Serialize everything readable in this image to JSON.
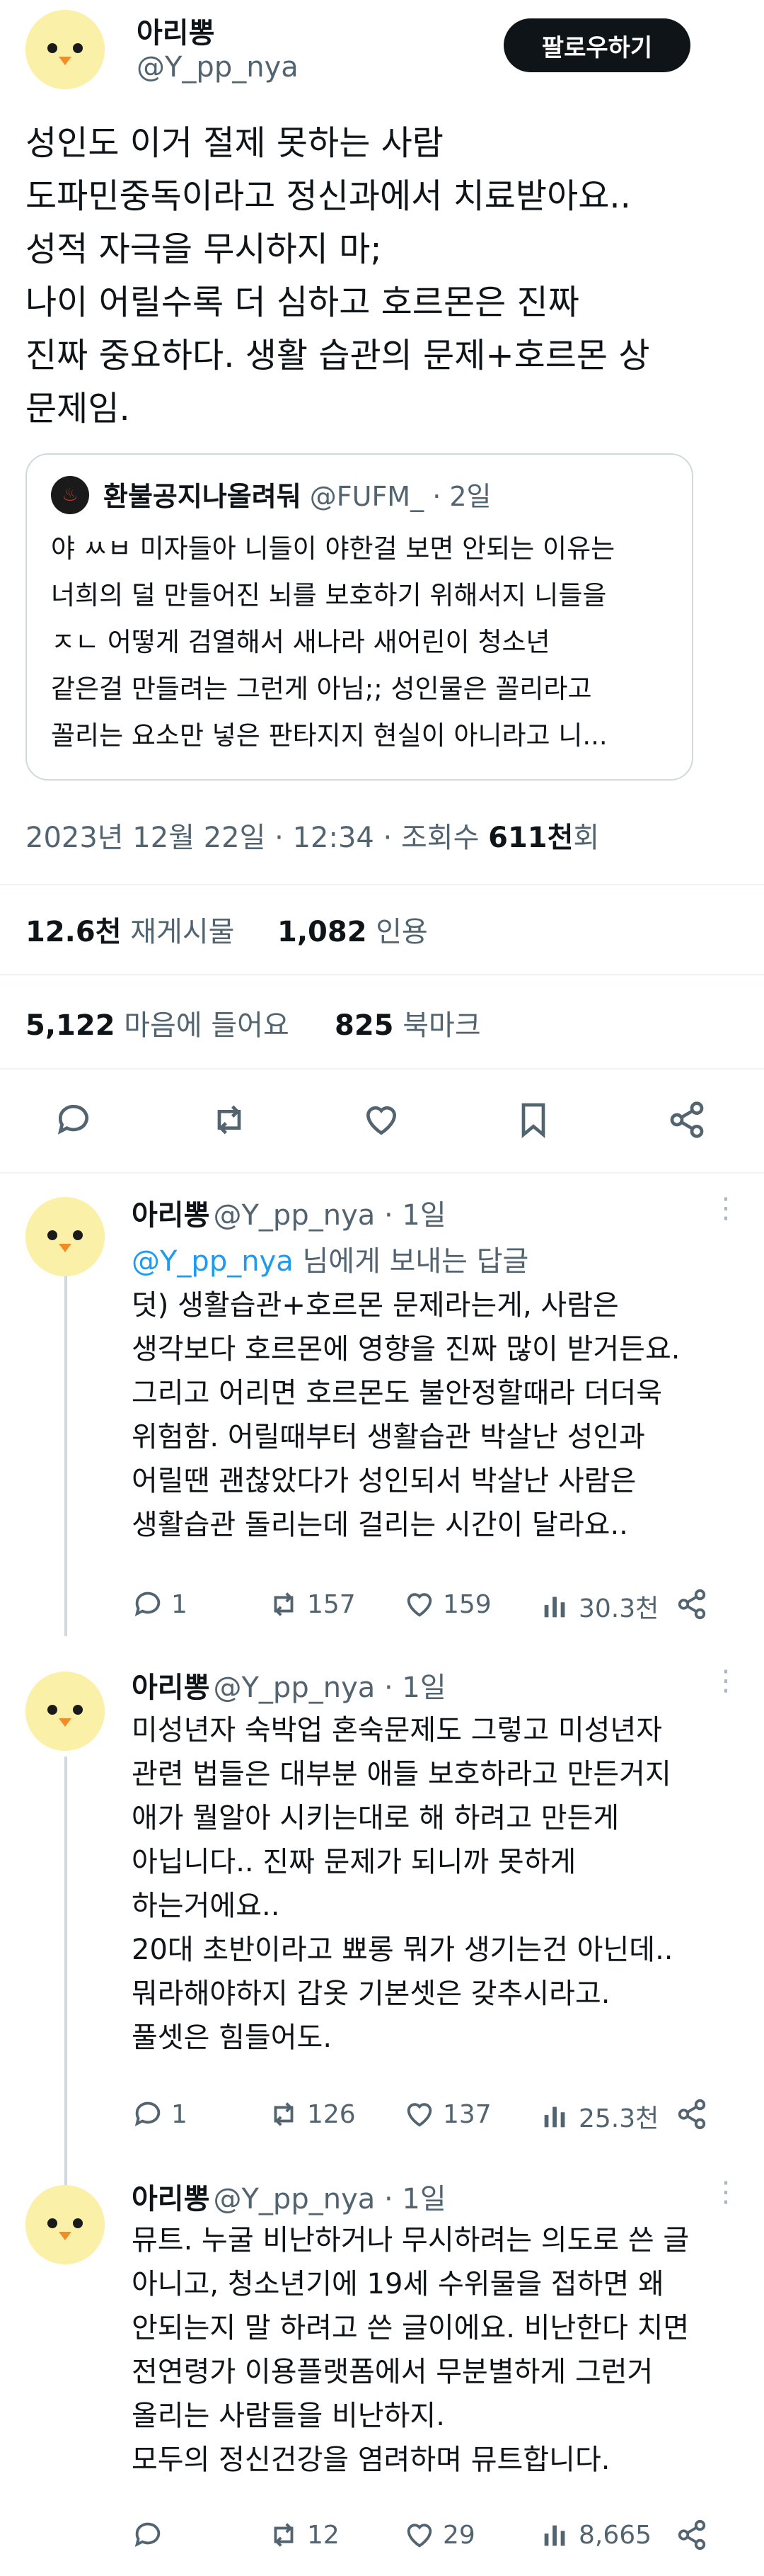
{
  "main": {
    "name": "아리뽕",
    "handle": "@Y_pp_nya",
    "follow_label": "팔로우하기",
    "body": "성인도 이거 절제 못하는 사람\n도파민중독이라고 정신과에서 치료받아요..\n성적 자극을 무시하지 마;\n나이 어릴수록 더 심하고 호르몬은 진짜\n진짜 중요하다. 생활 습관의 문제+호르몬 상\n문제임.",
    "timestamp": "2023년 12월 22일 · 12:34 · 조회수 ",
    "views": "611천",
    "views_suffix": "회",
    "retweets": "12.6천",
    "retweets_label": "재게시물",
    "quotes": "1,082",
    "quotes_label": "인용",
    "likes": "5,122",
    "likes_label": "마음에 들어요",
    "bookmarks": "825",
    "bookmarks_label": "북마크"
  },
  "quote": {
    "name": "환불공지나올려둬",
    "handle": "@FUFM_",
    "time": "· 2일",
    "text": "야 ㅆㅂ 미자들아 니들이 야한걸 보면 안되는 이유는\n너희의 덜 만들어진 뇌를 보호하기 위해서지 니들을\nㅈㄴ 어떻게 검열해서 새나라 새어린이 청소년\n같은걸 만들려는 그런게 아님;; 성인물은 꼴리라고\n꼴리는 요소만 넣은 판타지지 현실이 아니라고 니..."
  },
  "replies": [
    {
      "name": "아리뽕",
      "meta": "@Y_pp_nya · 1일",
      "reply_to_handle": "@Y_pp_nya",
      "reply_to_suffix": " 님에게 보내는 답글",
      "text": "덧) 생활습관+호르몬 문제라는게, 사람은\n생각보다 호르몬에 영향을 진짜 많이 받거든요.\n그리고 어리면 호르몬도 불안정할때라 더더욱\n위험함. 어릴때부터 생활습관 박살난 성인과\n어릴땐 괜찮았다가 성인되서 박살난 사람은\n생활습관 돌리는데 걸리는 시간이 달라요..",
      "replies": "1",
      "retweets": "157",
      "likes": "159",
      "views": "30.3천"
    },
    {
      "name": "아리뽕",
      "meta": "@Y_pp_nya · 1일",
      "text": "미성년자 숙박업 혼숙문제도 그렇고 미성년자\n관련 법들은 대부분 애들 보호하라고 만든거지\n애가 뭘알아 시키는대로 해 하려고 만든게\n아닙니다.. 진짜 문제가 되니까 못하게\n하는거에요..\n20대 초반이라고 뾰롱 뭐가 생기는건 아닌데..\n뭐라해야하지 갑옷 기본셋은 갖추시라고.\n풀셋은 힘들어도.",
      "replies": "1",
      "retweets": "126",
      "likes": "137",
      "views": "25.3천"
    },
    {
      "name": "아리뽕",
      "meta": "@Y_pp_nya · 1일",
      "text": "뮤트. 누굴 비난하거나 무시하려는 의도로 쓴 글\n아니고, 청소년기에 19세 수위물을 접하면 왜\n안되는지 말 하려고 쓴 글이에요. 비난한다 치면\n전연령가 이용플랫폼에서 무분별하게 그런거\n올리는 사람들을 비난하지.\n모두의 정신건강을 염려하며 뮤트합니다.",
      "replies": "",
      "retweets": "12",
      "likes": "29",
      "views": "8,665"
    }
  ],
  "icons": {
    "avatar": "chick-face-avatar",
    "reply": "reply-icon",
    "retweet": "retweet-icon",
    "like": "heart-icon",
    "bookmark": "bookmark-icon",
    "share": "share-icon",
    "views": "views-icon",
    "more": "more-icon"
  }
}
